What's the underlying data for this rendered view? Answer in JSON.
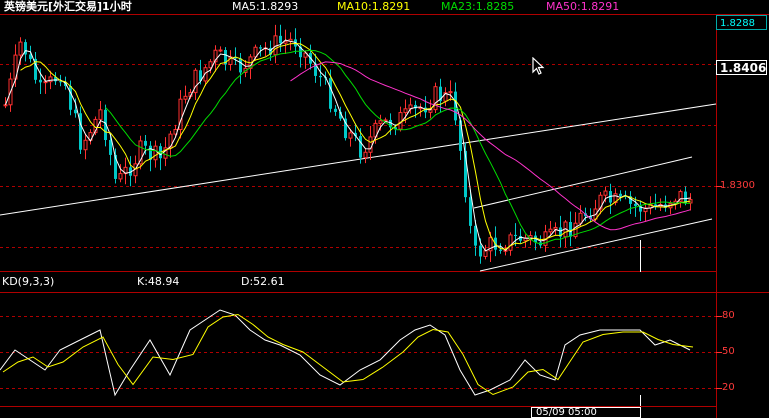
{
  "header": {
    "title": "英镑美元[外汇交易]1小时",
    "ma5": "MA5:1.8293",
    "ma10": "MA10:1.8291",
    "ma23": "MA23:1.8285",
    "ma50": "MA50:1.8291"
  },
  "price_axis": {
    "top_value": "1.8288",
    "current_value": "1.8406",
    "mid_tick": "1.8300"
  },
  "kd": {
    "label": "KD(9,3,3)",
    "k": "K:48.94",
    "d": "D:52.61",
    "ticks": [
      "80",
      "50",
      "20"
    ]
  },
  "bottom_label": "05/09 05:00",
  "colors": {
    "background": "#000000",
    "up_candle": "#ff3030",
    "down_candle": "#00c8c8",
    "ma5": "#ffffff",
    "ma10": "#ffff00",
    "ma23": "#00dd00",
    "ma50": "#ff33cc",
    "axis": "#ff3030",
    "grid": "#b00000"
  },
  "chart_data": {
    "type": "candlestick",
    "title": "英镑美元[外汇交易]1小时",
    "series": [
      {
        "name": "MA5:1.8293"
      },
      {
        "name": "MA10:1.8291"
      },
      {
        "name": "MA23:1.8285"
      },
      {
        "name": "MA50:1.8291"
      }
    ],
    "yticks": [
      "1.8288",
      "1.8300"
    ],
    "kd_series": [
      {
        "name": "K:48.94"
      },
      {
        "name": "D:52.61"
      }
    ],
    "kd_yticks": [
      "80",
      "50",
      "20"
    ],
    "kd_ylim": [
      0,
      100
    ]
  }
}
